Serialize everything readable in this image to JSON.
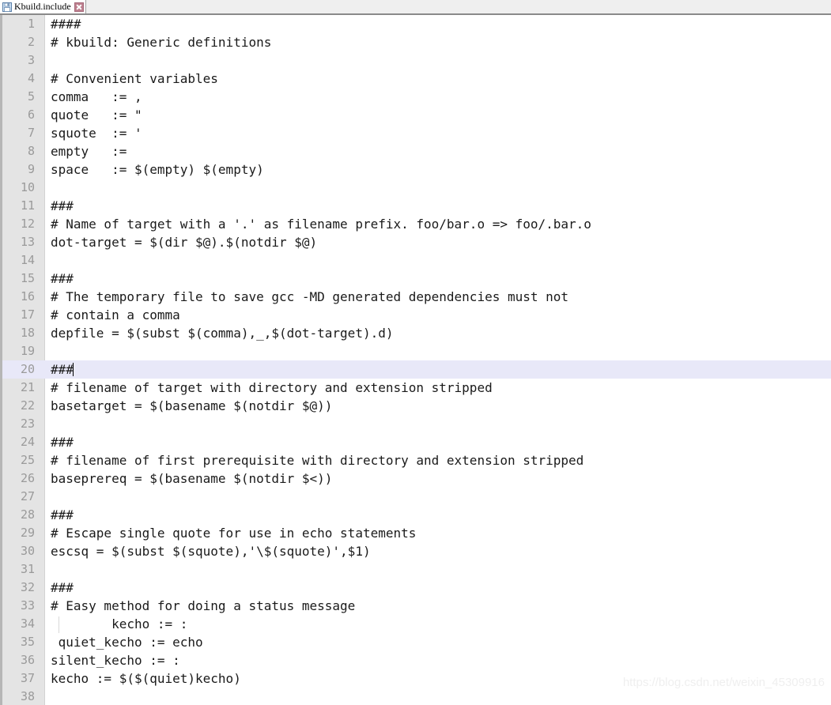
{
  "window": {
    "app_kind": "text-editor"
  },
  "tabbar": {
    "tabs": [
      {
        "title": "Kbuild.include",
        "save_icon": "floppy-save-icon",
        "close_icon": "close-icon",
        "active": true
      }
    ]
  },
  "editor": {
    "current_line": 20,
    "cursor_line": 20,
    "cursor_column": 4,
    "first_visible_line": 1,
    "last_visible_line": 38,
    "colors": {
      "background": "#ffffff",
      "gutter": "#e4e4e4",
      "line_number": "#9a9a9a",
      "text": "#1a1a1a",
      "current_line_highlight": "#e8e8f8",
      "tabbar": "#efefef",
      "tab_close": "#bd7f8e"
    },
    "lines": [
      {
        "n": 1,
        "text": "####"
      },
      {
        "n": 2,
        "text": "# kbuild: Generic definitions"
      },
      {
        "n": 3,
        "text": ""
      },
      {
        "n": 4,
        "text": "# Convenient variables"
      },
      {
        "n": 5,
        "text": "comma   := ,"
      },
      {
        "n": 6,
        "text": "quote   := \""
      },
      {
        "n": 7,
        "text": "squote  := '"
      },
      {
        "n": 8,
        "text": "empty   :="
      },
      {
        "n": 9,
        "text": "space   := $(empty) $(empty)"
      },
      {
        "n": 10,
        "text": ""
      },
      {
        "n": 11,
        "text": "###"
      },
      {
        "n": 12,
        "text": "# Name of target with a '.' as filename prefix. foo/bar.o => foo/.bar.o"
      },
      {
        "n": 13,
        "text": "dot-target = $(dir $@).$(notdir $@)"
      },
      {
        "n": 14,
        "text": ""
      },
      {
        "n": 15,
        "text": "###"
      },
      {
        "n": 16,
        "text": "# The temporary file to save gcc -MD generated dependencies must not"
      },
      {
        "n": 17,
        "text": "# contain a comma"
      },
      {
        "n": 18,
        "text": "depfile = $(subst $(comma),_,$(dot-target).d)"
      },
      {
        "n": 19,
        "text": ""
      },
      {
        "n": 20,
        "text": "###"
      },
      {
        "n": 21,
        "text": "# filename of target with directory and extension stripped"
      },
      {
        "n": 22,
        "text": "basetarget = $(basename $(notdir $@))"
      },
      {
        "n": 23,
        "text": ""
      },
      {
        "n": 24,
        "text": "###"
      },
      {
        "n": 25,
        "text": "# filename of first prerequisite with directory and extension stripped"
      },
      {
        "n": 26,
        "text": "baseprereq = $(basename $(notdir $<))"
      },
      {
        "n": 27,
        "text": ""
      },
      {
        "n": 28,
        "text": "###"
      },
      {
        "n": 29,
        "text": "# Escape single quote for use in echo statements"
      },
      {
        "n": 30,
        "text": "escsq = $(subst $(squote),'\\$(squote)',$1)"
      },
      {
        "n": 31,
        "text": ""
      },
      {
        "n": 32,
        "text": "###"
      },
      {
        "n": 33,
        "text": "# Easy method for doing a status message"
      },
      {
        "n": 34,
        "text": "        kecho := :"
      },
      {
        "n": 35,
        "text": " quiet_kecho := echo"
      },
      {
        "n": 36,
        "text": "silent_kecho := :"
      },
      {
        "n": 37,
        "text": "kecho := $($(quiet)kecho)"
      },
      {
        "n": 38,
        "text": ""
      }
    ]
  },
  "watermark": {
    "text": "https://blog.csdn.net/weixin_45309916"
  }
}
